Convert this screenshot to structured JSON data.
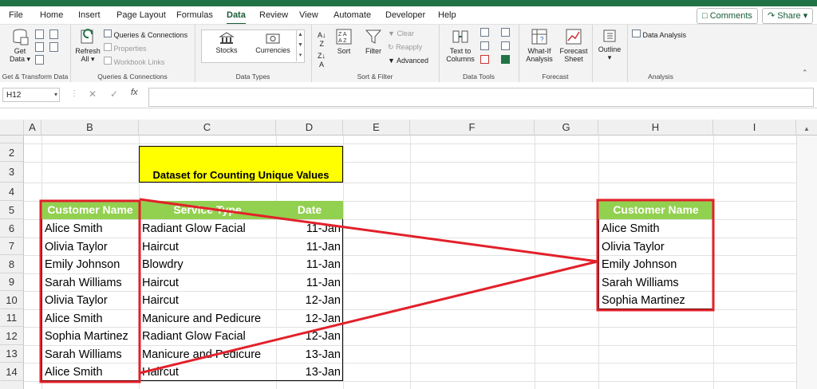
{
  "ribbon_tabs": [
    "File",
    "Home",
    "Insert",
    "Page Layout",
    "Formulas",
    "Data",
    "Review",
    "View",
    "Automate",
    "Developer",
    "Help"
  ],
  "active_tab": "Data",
  "comments_label": "Comments",
  "share_label": "Share",
  "ribbon": {
    "get_data": "Get Data",
    "get_transform_label": "Get & Transform Data",
    "refresh_all": "Refresh All",
    "queries_connections_btn": "Queries & Connections",
    "properties": "Properties",
    "workbook_links": "Workbook Links",
    "queries_group_label": "Queries & Connections",
    "stocks": "Stocks",
    "currencies": "Currencies",
    "data_types_label": "Data Types",
    "sort": "Sort",
    "filter": "Filter",
    "clear": "Clear",
    "reapply": "Reapply",
    "advanced": "Advanced",
    "sort_filter_label": "Sort & Filter",
    "text_to_columns": "Text to Columns",
    "data_tools_label": "Data Tools",
    "what_if": "What-If Analysis",
    "forecast_sheet": "Forecast Sheet",
    "forecast_label": "Forecast",
    "outline": "Outline",
    "data_analysis": "Data Analysis",
    "analysis_label": "Analysis"
  },
  "formula_bar": {
    "name_box": "H12",
    "fx": "fx",
    "value": ""
  },
  "columns": [
    "A",
    "B",
    "C",
    "D",
    "E",
    "F",
    "G",
    "H",
    "I"
  ],
  "rows": [
    "2",
    "3",
    "4",
    "5",
    "6",
    "7",
    "8",
    "9",
    "10",
    "11",
    "12",
    "13",
    "14"
  ],
  "sheet": {
    "title": "Dataset for Counting Unique Values",
    "headers": [
      "Customer Name",
      "Service Type",
      "Date"
    ],
    "data": [
      [
        "Alice Smith",
        "Radiant Glow Facial",
        "11-Jan"
      ],
      [
        "Olivia Taylor",
        "Haircut",
        "11-Jan"
      ],
      [
        "Emily Johnson",
        "Blowdry",
        "11-Jan"
      ],
      [
        "Sarah Williams",
        "Haircut",
        "11-Jan"
      ],
      [
        "Olivia Taylor",
        "Haircut",
        "12-Jan"
      ],
      [
        "Alice Smith",
        "Manicure and Pedicure",
        "12-Jan"
      ],
      [
        "Sophia Martinez",
        "Radiant Glow Facial",
        "12-Jan"
      ],
      [
        "Sarah Williams",
        "Manicure and Pedicure",
        "13-Jan"
      ],
      [
        "Alice Smith",
        "Haircut",
        "13-Jan"
      ]
    ],
    "unique_header": "Customer Name",
    "unique_names": [
      "Alice Smith",
      "Olivia Taylor",
      "Emily Johnson",
      "Sarah Williams",
      "Sophia Martinez"
    ]
  },
  "colors": {
    "excel_green": "#217346",
    "header_fill": "#92d050",
    "title_fill": "#ffff00",
    "highlight_red": "#e2202a"
  }
}
